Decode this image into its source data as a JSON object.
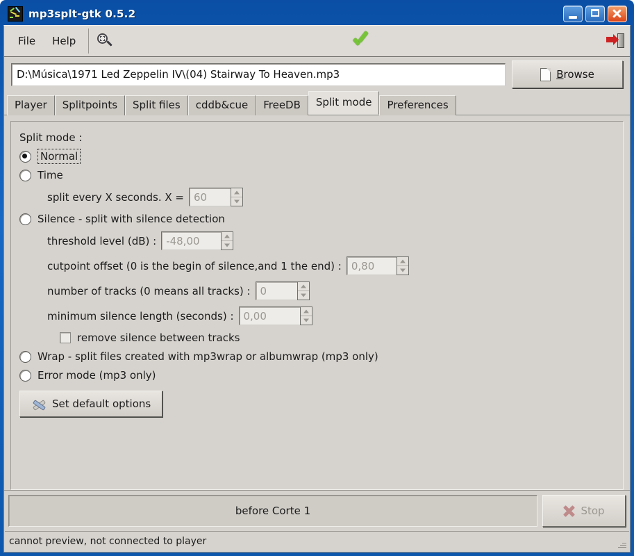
{
  "window": {
    "title": "mp3splt-gtk 0.5.2",
    "icon": "app-waveform-icon",
    "controls": {
      "minimize": "minimize-icon",
      "maximize": "maximize-icon",
      "close": "close-icon"
    }
  },
  "menu": {
    "items": [
      {
        "label": "File"
      },
      {
        "label": "Help"
      }
    ]
  },
  "toolbar": {
    "detect_silence_icon": "magnifier-icon",
    "ok_icon": "green-check-icon",
    "quit_icon": "exit-door-icon"
  },
  "path": {
    "value": "D:\\Música\\1971 Led Zeppelin IV\\(04) Stairway To Heaven.mp3",
    "browse_label_prefix": "B",
    "browse_label_rest": "rowse"
  },
  "tabs": [
    {
      "label": "Player",
      "active": false
    },
    {
      "label": "Splitpoints",
      "active": false
    },
    {
      "label": "Split files",
      "active": false
    },
    {
      "label": "cddb&cue",
      "active": false
    },
    {
      "label": "FreeDB",
      "active": false
    },
    {
      "label": "Split mode",
      "active": true
    },
    {
      "label": "Preferences",
      "active": false
    }
  ],
  "split_mode": {
    "group_label": "Split mode :",
    "options": {
      "normal": "Normal",
      "time": "Time",
      "silence": "Silence - split with silence detection",
      "wrap": "Wrap - split files created with mp3wrap or albumwrap (mp3 only)",
      "error": "Error mode (mp3 only)"
    },
    "selected": "normal",
    "time_fields": {
      "seconds_label": "split every X seconds. X =",
      "seconds_value": "60"
    },
    "silence_fields": {
      "threshold_label": "threshold level (dB) :",
      "threshold_value": "-48,00",
      "offset_label": "cutpoint offset (0 is the begin of silence,and 1 the end) :",
      "offset_value": "0,80",
      "tracks_label": "number of tracks (0 means all tracks) :",
      "tracks_value": "0",
      "minlen_label": "minimum silence length (seconds) :",
      "minlen_value": "0,00",
      "remove_silence_label": "remove silence between tracks",
      "remove_silence_checked": false
    },
    "defaults_button": "Set default options",
    "defaults_icon": "tools-icon"
  },
  "bottom": {
    "progress_text": "before Corte 1",
    "stop_label": "Stop",
    "stop_icon": "red-x-icon",
    "status_text": "cannot preview, not connected to player"
  }
}
